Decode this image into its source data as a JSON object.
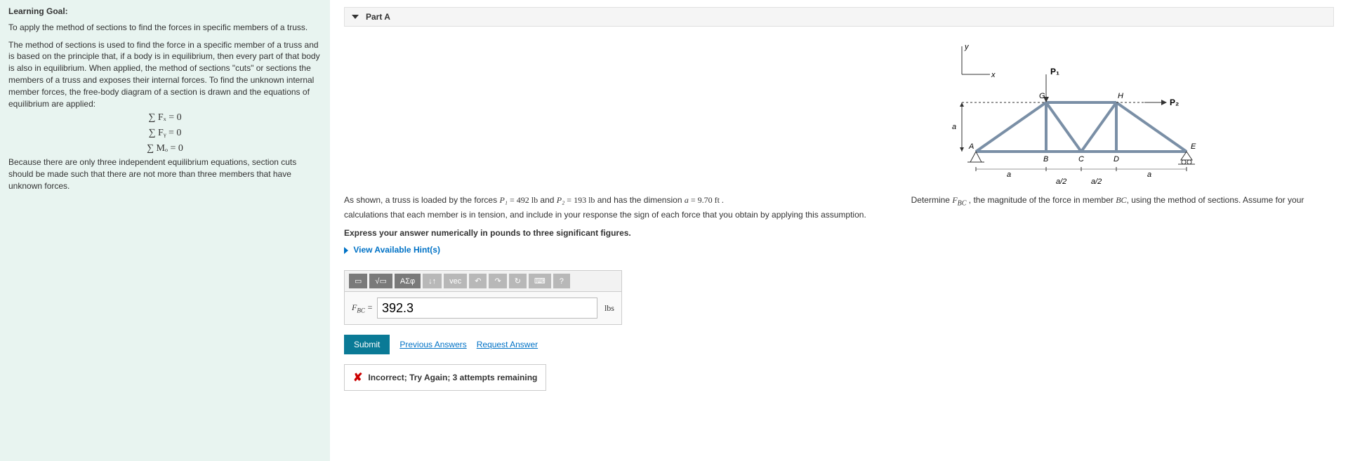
{
  "left": {
    "heading": "Learning Goal:",
    "p1": "To apply the method of sections to find the forces in specific members of a truss.",
    "p2": "The method of sections is used to find the force in a specific member of a truss and is based on the principle that, if a body is in equilibrium, then every part of that body is also in equilibrium. When applied, the method of sections \"cuts\" or sections the members of a truss and exposes their internal forces. To find the unknown internal member forces, the free-body diagram of a section is drawn and the equations of equilibrium are applied:",
    "eq1": "∑ Fₓ = 0",
    "eq2": "∑ Fᵧ = 0",
    "eq3": "∑ Mₒ = 0",
    "p3": "Because there are only three independent equilibrium equations, section cuts should be made such that there are not more than three members that have unknown forces."
  },
  "part": {
    "label": "Part A"
  },
  "truss": {
    "labels": {
      "y": "y",
      "x": "x",
      "P1": "P₁",
      "P2": "P₂",
      "G": "G",
      "H": "H",
      "A": "A",
      "B": "B",
      "C": "C",
      "D": "D",
      "E": "E",
      "a": "a",
      "ah": "a/2"
    }
  },
  "question": {
    "pre": "As shown, a truss is loaded by the forces ",
    "P1sym": "P₁",
    "P1val": " = 492 lb",
    "and": " and ",
    "P2sym": "P₂",
    "P2val": " = 193 lb",
    "dim_pre": " and has the dimension ",
    "asym": "a",
    "aval": " = 9.70 ft .",
    "det_pre": " Determine ",
    "Fbc": "F_BC",
    "det_post": " , the magnitude of the force in member ",
    "member": "BC",
    "tail": ", using the method of sections. Assume for your calculations that each member is in tension, and include in your response the sign of each force that you obtain by applying this assumption.",
    "instr": "Express your answer numerically in pounds to three significant figures.",
    "hints": "View Available Hint(s)"
  },
  "toolbar": {
    "sqrt": "√",
    "greek": "ΑΣφ",
    "updown": "↓↑",
    "vec": "vec",
    "undo": "↶",
    "redo": "↷",
    "reset": "↻",
    "kb": "⌨",
    "help": "?"
  },
  "answer": {
    "label_pre": "F",
    "label_sub": "BC",
    "equals": " = ",
    "value": "392.3",
    "unit": "lbs"
  },
  "actions": {
    "submit": "Submit",
    "prev": "Previous Answers",
    "request": "Request Answer"
  },
  "feedback": {
    "text": "Incorrect; Try Again; 3 attempts remaining"
  },
  "chart_data": {
    "type": "diagram",
    "description": "Truss diagram with supports A (left) and E (right) on bottom chord, top chord G-H, vertical load P1 at G downward, horizontal load P2 at H rightward. Bottom nodes A,B,C,D,E. Height a. Bottom spans: A-B = a, B-C = a/2, C-D = a/2, D-E = a.",
    "loads": {
      "P1": 492,
      "P2": 193
    },
    "dimension_a_ft": 9.7
  }
}
